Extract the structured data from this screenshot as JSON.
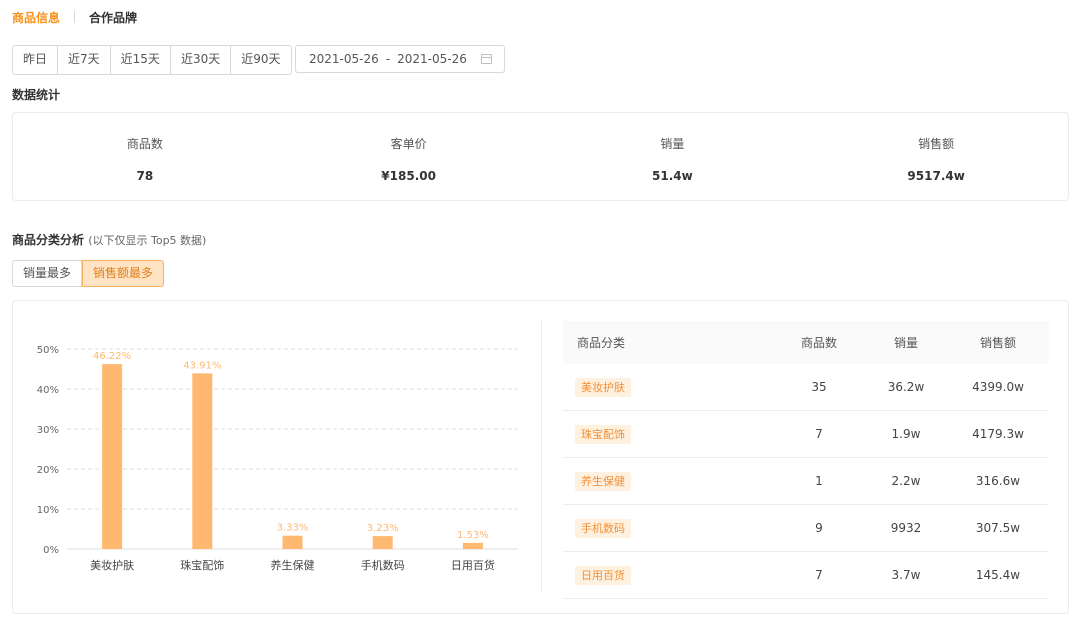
{
  "tabs": [
    {
      "label": "商品信息",
      "active": true
    },
    {
      "label": "合作品牌",
      "active": false
    }
  ],
  "date_ranges": [
    "昨日",
    "近7天",
    "近15天",
    "近30天",
    "近90天"
  ],
  "date_picker": {
    "start": "2021-05-26",
    "separator": "-",
    "end": "2021-05-26"
  },
  "stats_title": "数据统计",
  "stats": [
    {
      "label": "商品数",
      "value": "78"
    },
    {
      "label": "客单价",
      "value": "¥185.00"
    },
    {
      "label": "销量",
      "value": "51.4w"
    },
    {
      "label": "销售额",
      "value": "9517.4w"
    }
  ],
  "analysis": {
    "title": "商品分类分析",
    "note": "(以下仅显示 Top5 数据)",
    "sort_options": [
      {
        "label": "销量最多",
        "active": false
      },
      {
        "label": "销售额最多",
        "active": true
      }
    ]
  },
  "table": {
    "headers": {
      "category": "商品分类",
      "count": "商品数",
      "sales": "销量",
      "amount": "销售额"
    },
    "rows": [
      {
        "category": "美妆护肤",
        "count": "35",
        "sales": "36.2w",
        "amount": "4399.0w"
      },
      {
        "category": "珠宝配饰",
        "count": "7",
        "sales": "1.9w",
        "amount": "4179.3w"
      },
      {
        "category": "养生保健",
        "count": "1",
        "sales": "2.2w",
        "amount": "316.6w"
      },
      {
        "category": "手机数码",
        "count": "9",
        "sales": "9932",
        "amount": "307.5w"
      },
      {
        "category": "日用百货",
        "count": "7",
        "sales": "3.7w",
        "amount": "145.4w"
      }
    ]
  },
  "chart_data": {
    "type": "bar",
    "categories": [
      "美妆护肤",
      "珠宝配饰",
      "养生保健",
      "手机数码",
      "日用百货"
    ],
    "values": [
      46.22,
      43.91,
      3.33,
      3.23,
      1.53
    ],
    "data_labels": [
      "46.22%",
      "43.91%",
      "3.33%",
      "3.23%",
      "1.53%"
    ],
    "yticks": [
      "0%",
      "10%",
      "20%",
      "30%",
      "40%",
      "50%"
    ],
    "ylim": [
      0,
      50
    ],
    "grid": true,
    "bar_color": "#ffb870",
    "label_color": "#ffb870"
  },
  "colors": {
    "accent": "#f7931e",
    "tag_bg": "#fff1e0",
    "tag_text": "#f09036"
  }
}
